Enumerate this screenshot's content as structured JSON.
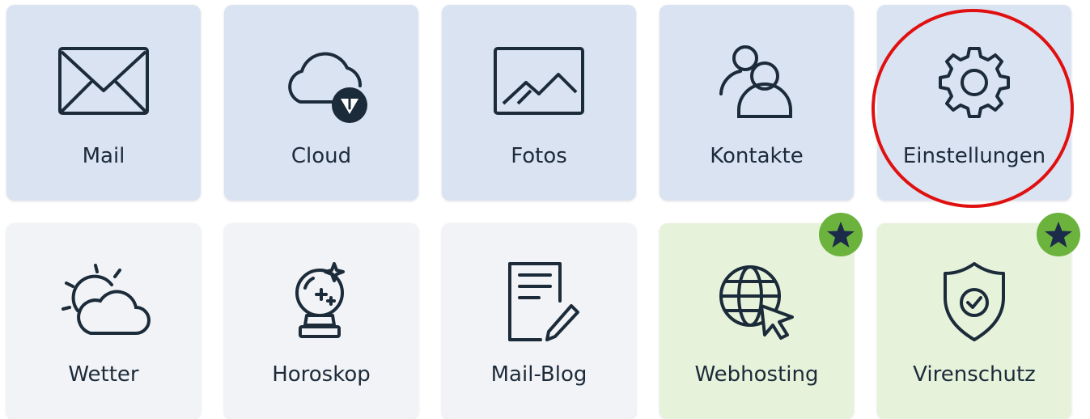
{
  "colors": {
    "tile_primary": "#dae3f2",
    "tile_secondary": "#f2f3f6",
    "tile_premium": "#e6f2da",
    "icon_stroke": "#1c2b3a",
    "badge_green": "#6cb33e",
    "star_navy": "#1c2b4a",
    "highlight_red": "#e01010"
  },
  "tiles": [
    {
      "label": "Mail",
      "icon": "mail-icon",
      "style": "primary"
    },
    {
      "label": "Cloud",
      "icon": "cloud-icon",
      "style": "primary"
    },
    {
      "label": "Fotos",
      "icon": "photo-icon",
      "style": "primary"
    },
    {
      "label": "Kontakte",
      "icon": "contacts-icon",
      "style": "primary"
    },
    {
      "label": "Einstellungen",
      "icon": "gear-icon",
      "style": "primary",
      "highlighted": true
    },
    {
      "label": "Wetter",
      "icon": "weather-icon",
      "style": "secondary"
    },
    {
      "label": "Horoskop",
      "icon": "crystal-ball-icon",
      "style": "secondary"
    },
    {
      "label": "Mail-Blog",
      "icon": "blog-icon",
      "style": "secondary"
    },
    {
      "label": "Webhosting",
      "icon": "globe-cursor-icon",
      "style": "premium",
      "badge": "star-icon"
    },
    {
      "label": "Virenschutz",
      "icon": "shield-check-icon",
      "style": "premium",
      "badge": "star-icon"
    }
  ]
}
